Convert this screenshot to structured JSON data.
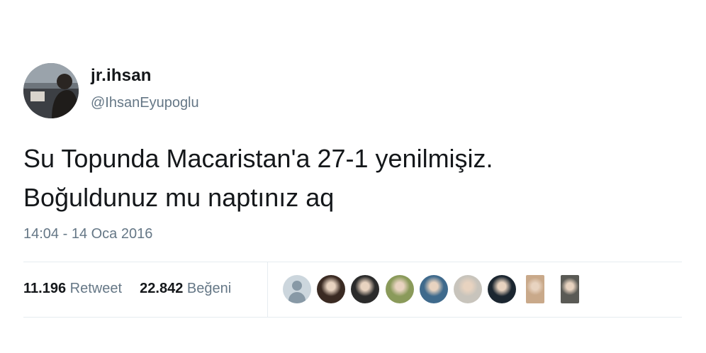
{
  "user": {
    "display_name": "jr.ihsan",
    "handle": "@IhsanEyupoglu"
  },
  "tweet": {
    "text_lines": [
      "Su Topunda Macaristan'a 27-1 yenilmişiz.",
      "Boğuldunuz mu naptınız aq"
    ],
    "timestamp": "14:04 - 14 Oca 2016"
  },
  "stats": {
    "retweet_count": "11.196",
    "retweet_label": "Retweet",
    "like_count": "22.842",
    "like_label": "Beğeni"
  },
  "likers": [
    {
      "kind": "default",
      "color": "#ccd6dd"
    },
    {
      "kind": "photo",
      "color": "#3a2a22"
    },
    {
      "kind": "photo",
      "color": "#2b2b2b"
    },
    {
      "kind": "photo",
      "color": "#8a9a5a"
    },
    {
      "kind": "photo",
      "color": "#3f6a8c"
    },
    {
      "kind": "photo",
      "color": "#c8c4bc"
    },
    {
      "kind": "photo",
      "color": "#1b2630"
    },
    {
      "kind": "portrait",
      "color": "#c9a98a"
    },
    {
      "kind": "portrait",
      "color": "#5a5a55"
    }
  ]
}
